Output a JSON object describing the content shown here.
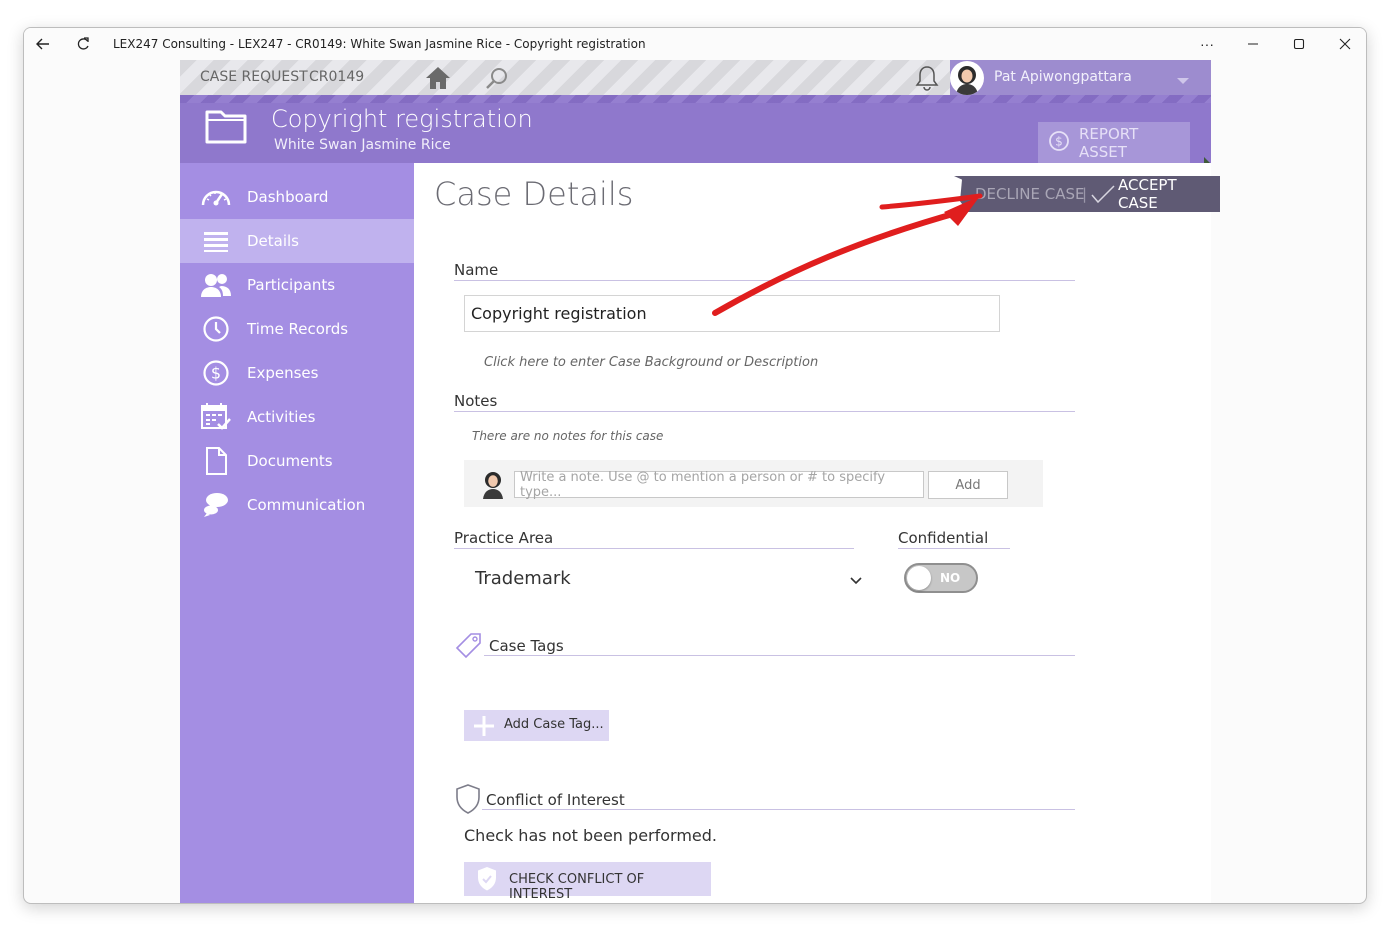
{
  "window": {
    "title": "LEX247 Consulting - LEX247 - CR0149: White Swan Jasmine Rice - Copyright registration"
  },
  "topbar": {
    "crumb_type": "CASE REQUEST",
    "crumb_id": "CR0149",
    "user_name": "Pat Apiwongpattara"
  },
  "header": {
    "title": "Copyright registration",
    "subtitle": "White Swan Jasmine Rice",
    "report_asset_label": "REPORT ASSET"
  },
  "sidebar": {
    "items": [
      {
        "label": "Dashboard",
        "icon": "dashboard-icon"
      },
      {
        "label": "Details",
        "icon": "list-icon",
        "active": true
      },
      {
        "label": "Participants",
        "icon": "people-icon"
      },
      {
        "label": "Time Records",
        "icon": "clock-icon"
      },
      {
        "label": "Expenses",
        "icon": "dollar-icon"
      },
      {
        "label": "Activities",
        "icon": "calendar-check-icon"
      },
      {
        "label": "Documents",
        "icon": "document-icon"
      },
      {
        "label": "Communication",
        "icon": "chat-icon"
      }
    ]
  },
  "content": {
    "heading": "Case Details",
    "decline_label": "DECLINE CASE",
    "accept_label": "ACCEPT CASE",
    "name_label": "Name",
    "name_value": "Copyright registration",
    "description_hint": "Click here to enter Case Background or Description",
    "notes_label": "Notes",
    "notes_empty": "There are no notes for this case",
    "note_placeholder": "Write a note. Use @ to mention a person or # to specify type...",
    "add_label": "Add",
    "practice_area_label": "Practice Area",
    "practice_area_value": "Trademark",
    "confidential_label": "Confidential",
    "confidential_value": "NO",
    "case_tags_label": "Case Tags",
    "add_tag_label": "Add Case Tag...",
    "conflict_label": "Conflict of Interest",
    "conflict_status": "Check has not been performed.",
    "check_conflict_label": "CHECK CONFLICT OF INTEREST"
  },
  "colors": {
    "sidebar": "#a48ee3",
    "sidebar_active": "#c0b2ee",
    "header": "#8f78cc",
    "accept_bar": "#5f5a74",
    "annotation_arrow": "#e01e1e"
  }
}
